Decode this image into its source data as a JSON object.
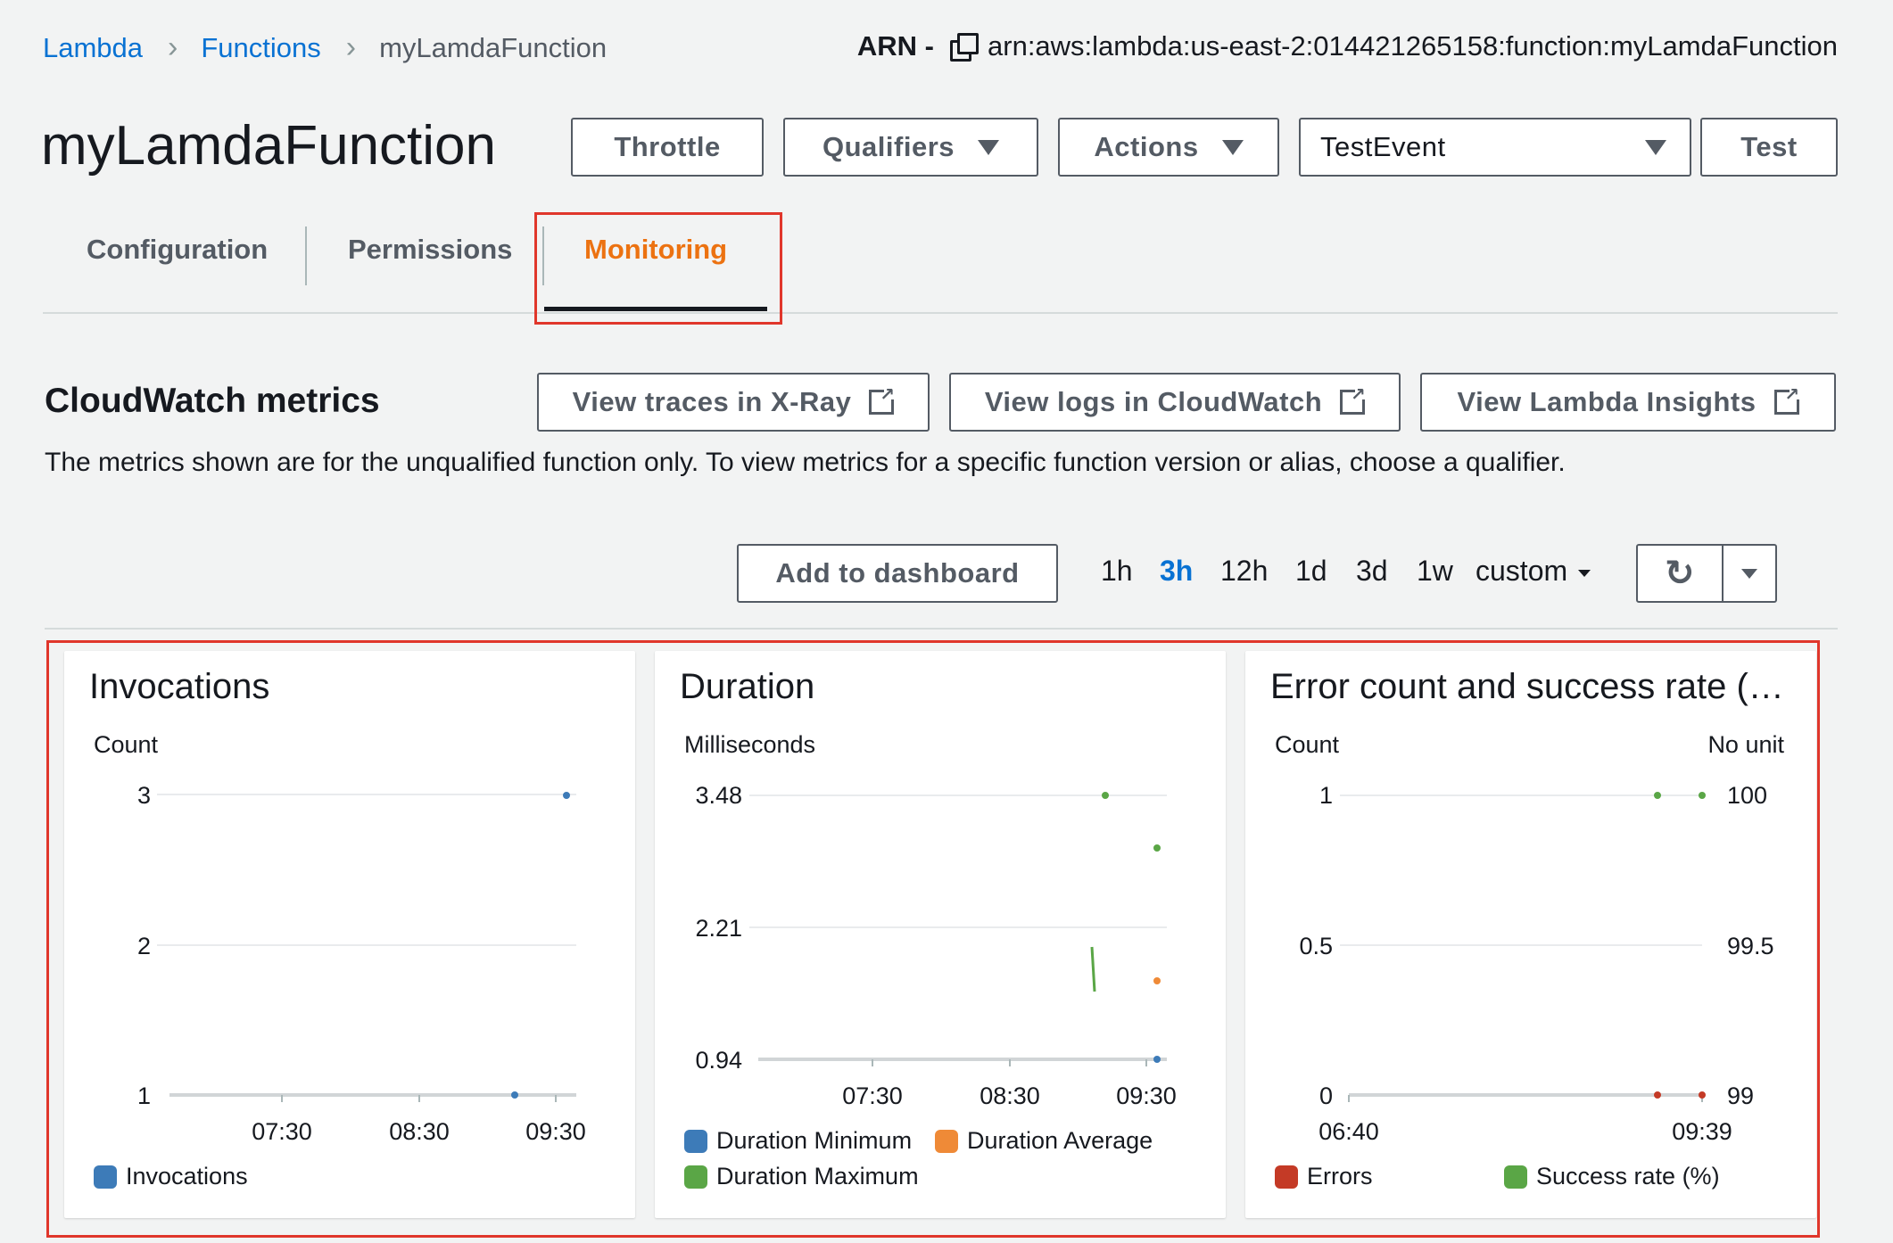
{
  "breadcrumb": {
    "items": [
      "Lambda",
      "Functions",
      "myLamdaFunction"
    ]
  },
  "arn": {
    "label": "ARN -",
    "value": "arn:aws:lambda:us-east-2:014421265158:function:myLamdaFunction"
  },
  "header": {
    "title": "myLamdaFunction",
    "throttle": "Throttle",
    "qualifiers": "Qualifiers",
    "actions": "Actions",
    "test_event": "TestEvent",
    "test": "Test"
  },
  "tabs": [
    {
      "label": "Configuration",
      "active": false
    },
    {
      "label": "Permissions",
      "active": false
    },
    {
      "label": "Monitoring",
      "active": true
    }
  ],
  "cloudwatch": {
    "title": "CloudWatch metrics",
    "xray": "View traces in X-Ray",
    "logs": "View logs in CloudWatch",
    "insights": "View Lambda Insights",
    "description": "The metrics shown are for the unqualified function only. To view metrics for a specific function version or alias, choose a qualifier."
  },
  "toolbar": {
    "add_dashboard": "Add to dashboard",
    "ranges": [
      "1h",
      "3h",
      "12h",
      "1d",
      "3d",
      "1w"
    ],
    "selected_range": "3h",
    "custom": "custom"
  },
  "colors": {
    "accent": "#ec7211",
    "link": "#0972d3",
    "highlight": "#e0362b",
    "blue": "#3d7bb8",
    "orange": "#ef8a37",
    "green": "#5aa646",
    "red": "#c43a26"
  },
  "chart_data": [
    {
      "type": "scatter",
      "title": "Invocations",
      "ylabel": "Count",
      "yticks": [
        "3",
        "2",
        "1"
      ],
      "ylim": [
        1,
        3
      ],
      "xticks": [
        "07:30",
        "08:30",
        "09:30"
      ],
      "series": [
        {
          "name": "Invocations",
          "color": "#3d7bb8",
          "points": [
            [
              "09:15",
              1
            ],
            [
              "09:35",
              3
            ]
          ]
        }
      ]
    },
    {
      "type": "scatter",
      "title": "Duration",
      "ylabel": "Milliseconds",
      "yticks": [
        "3.48",
        "2.21",
        "0.94"
      ],
      "ylim": [
        0.94,
        3.48
      ],
      "xticks": [
        "07:30",
        "08:30",
        "09:30"
      ],
      "series": [
        {
          "name": "Duration Minimum",
          "color": "#3d7bb8",
          "points": [
            [
              "09:35",
              0.94
            ]
          ]
        },
        {
          "name": "Duration Average",
          "color": "#ef8a37",
          "points": [
            [
              "09:35",
              1.68
            ]
          ]
        },
        {
          "name": "Duration Maximum",
          "color": "#5aa646",
          "points": [
            [
              "09:13",
              3.48
            ],
            [
              "09:35",
              2.98
            ],
            [
              "09:08",
              2.06
            ],
            [
              "09:09",
              1.62
            ]
          ]
        }
      ]
    },
    {
      "type": "scatter",
      "title": "Error count and success rate (…",
      "ylabel": "Count",
      "y2label": "No unit",
      "yticks": [
        "1",
        "0.5",
        "0"
      ],
      "y2ticks": [
        "100",
        "99.5",
        "99"
      ],
      "ylim": [
        0,
        1
      ],
      "y2lim": [
        99,
        100
      ],
      "xticks": [
        "06:40",
        "09:39"
      ],
      "series": [
        {
          "name": "Errors",
          "color": "#c43a26",
          "points": [
            [
              "09:15",
              0
            ],
            [
              "09:39",
              0
            ]
          ]
        },
        {
          "name": "Success rate (%)",
          "color": "#5aa646",
          "points": [
            [
              "09:15",
              100
            ],
            [
              "09:39",
              100
            ]
          ]
        }
      ]
    }
  ]
}
